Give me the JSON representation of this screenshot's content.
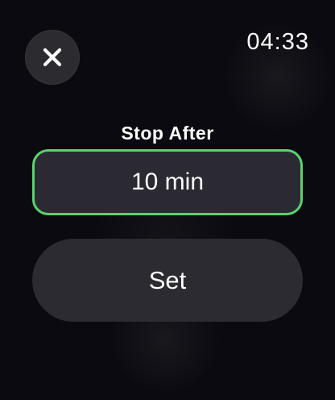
{
  "status": {
    "time": "04:33"
  },
  "header": {
    "close_icon": "close-icon"
  },
  "stop_after": {
    "title": "Stop After",
    "value": "10 min",
    "accent_color": "#5ad16e"
  },
  "actions": {
    "set_label": "Set"
  }
}
